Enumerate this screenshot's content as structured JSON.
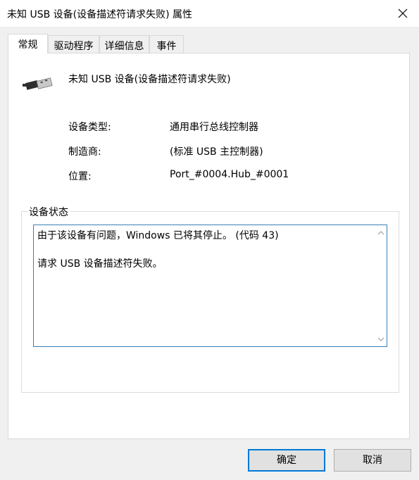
{
  "window": {
    "title": "未知 USB 设备(设备描述符请求失败) 属性"
  },
  "tabs": [
    {
      "label": "常规",
      "active": true
    },
    {
      "label": "驱动程序",
      "active": false
    },
    {
      "label": "详细信息",
      "active": false
    },
    {
      "label": "事件",
      "active": false
    }
  ],
  "general": {
    "device_name": "未知 USB 设备(设备描述符请求失败)",
    "device_icon": "usb-plug-icon",
    "properties": [
      {
        "label": "设备类型:",
        "value": "通用串行总线控制器"
      },
      {
        "label": "制造商:",
        "value": "(标准 USB 主控制器)"
      },
      {
        "label": "位置:",
        "value": "Port_#0004.Hub_#0001"
      }
    ],
    "status_group_label": "设备状态",
    "status_lines": [
      "由于该设备有问题，Windows 已将其停止。 (代码 43)",
      "请求 USB 设备描述符失败。"
    ]
  },
  "buttons": {
    "ok": "确定",
    "cancel": "取消"
  },
  "colors": {
    "accent": "#0078d7",
    "status_border": "#3a7fb5"
  }
}
